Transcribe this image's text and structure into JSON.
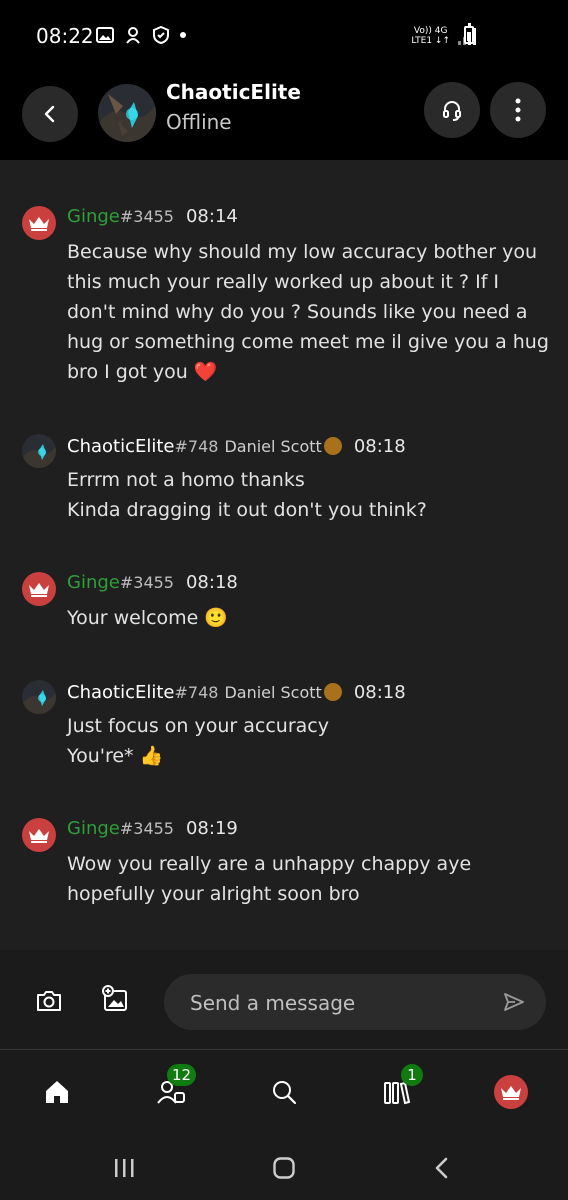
{
  "status_bar": {
    "time": "08:22",
    "network_top": "Vo)) 4G",
    "network_bottom": "LTE1 ↓↑"
  },
  "header": {
    "name": "ChaoticElite",
    "status": "Offline",
    "icons": [
      "back-icon",
      "party-chat-icon",
      "more-options-icon"
    ]
  },
  "messages": [
    {
      "sender": "Ginge",
      "tag": "#3455",
      "time": "08:14",
      "lines": [
        "Because why should my low accuracy bother you",
        "this much your really worked up about it ? If I",
        "don't mind why do you ? Sounds like you need a",
        "hug or something come meet me il give you a hug",
        "bro I got you ❤️"
      ]
    },
    {
      "sender": "ChaoticElite",
      "tag": "#748",
      "real_name": "Daniel Scott",
      "time": "08:18",
      "lines": [
        "Errrm not a homo thanks",
        "Kinda dragging it out don't you think?"
      ]
    },
    {
      "sender": "Ginge",
      "tag": "#3455",
      "time": "08:18",
      "lines": [
        "Your welcome 🙂"
      ]
    },
    {
      "sender": "ChaoticElite",
      "tag": "#748",
      "real_name": "Daniel Scott",
      "time": "08:18",
      "lines": [
        "Just focus on your accuracy",
        "You're* 👍"
      ]
    },
    {
      "sender": "Ginge",
      "tag": "#3455",
      "time": "08:19",
      "lines": [
        "Wow you really are a unhappy chappy aye",
        "hopefully your alright soon bro"
      ]
    }
  ],
  "composer": {
    "placeholder": "Send a message"
  },
  "bottom_nav": {
    "social_badge": "12",
    "library_badge": "1"
  },
  "colors": {
    "accent_green": "#107c10",
    "gamertag_green": "#2e9f3a",
    "chat_bg": "#1f1f1f",
    "crown_avatar": "#c9403f"
  }
}
